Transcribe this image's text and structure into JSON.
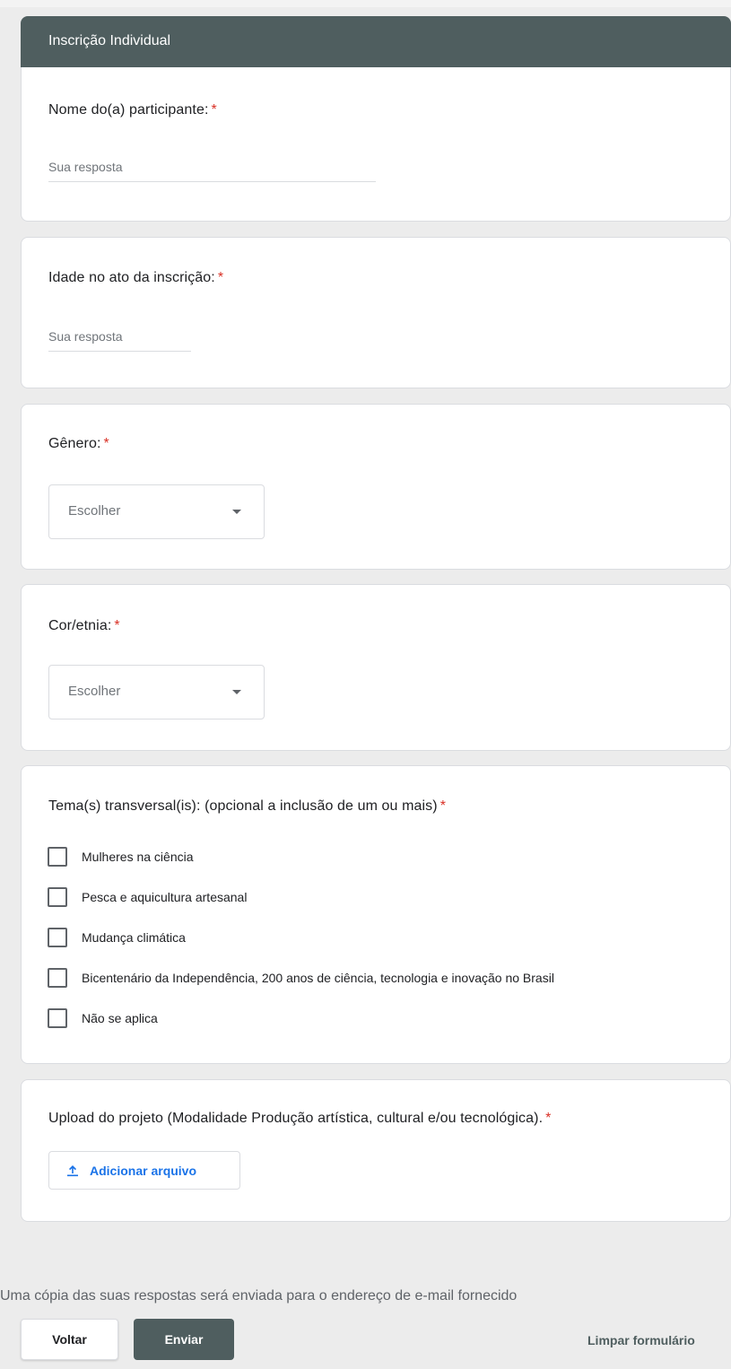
{
  "section": {
    "title": "Inscrição Individual"
  },
  "questions": {
    "name": {
      "label": "Nome do(a) participante:",
      "required_mark": "*",
      "placeholder": "Sua resposta",
      "value": ""
    },
    "age": {
      "label": "Idade no ato da inscrição:",
      "required_mark": "*",
      "placeholder": "Sua resposta",
      "value": ""
    },
    "gender": {
      "label": "Gênero:",
      "required_mark": "*",
      "selected": "Escolher"
    },
    "ethnicity": {
      "label": "Cor/etnia:",
      "required_mark": "*",
      "selected": "Escolher"
    },
    "themes": {
      "label": "Tema(s) transversal(is): (opcional a inclusão de um ou mais)",
      "required_mark": "*",
      "options": [
        "Mulheres na ciência",
        "Pesca e aquicultura artesanal",
        "Mudança climática",
        "Bicentenário da Independência, 200 anos de ciência, tecnologia e inovação no Brasil",
        "Não se aplica"
      ]
    },
    "upload": {
      "label": "Upload do projeto (Modalidade Produção artística, cultural e/ou tecnológica).",
      "required_mark": "*",
      "button_label": "Adicionar arquivo"
    }
  },
  "footer": {
    "note": "Uma cópia das suas respostas será enviada para o endereço de e-mail fornecido",
    "back_label": "Voltar",
    "submit_label": "Enviar",
    "clear_label": "Limpar formulário"
  },
  "colors": {
    "header_bg": "#4f5e5f",
    "required": "#d93025",
    "link_blue": "#1a73e8",
    "page_bg": "#ececec"
  },
  "icons": {
    "upload": "upload-icon",
    "dropdown": "caret-down-icon",
    "checkbox": "checkbox-unchecked-icon"
  }
}
